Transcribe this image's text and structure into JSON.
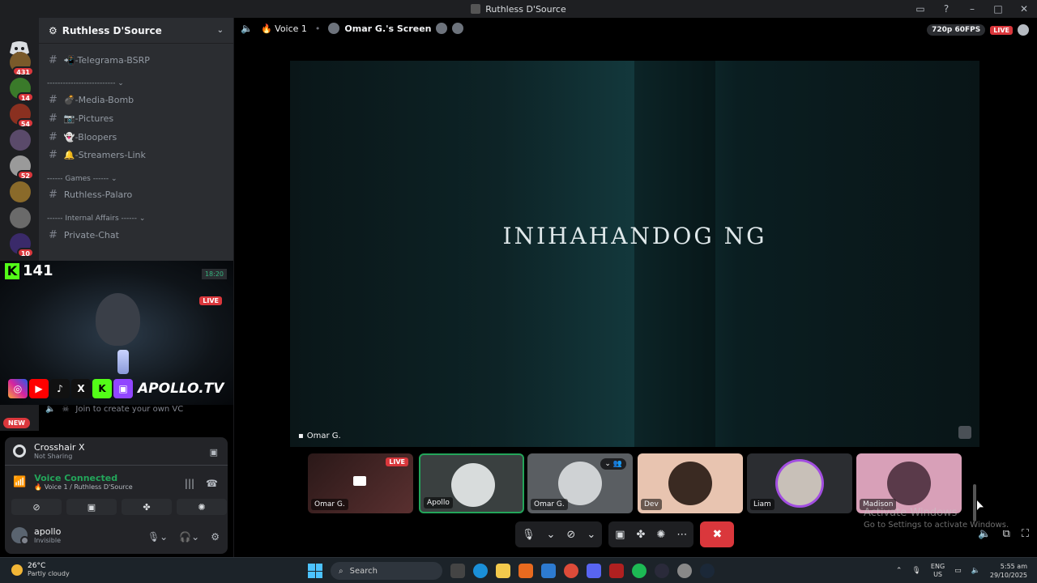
{
  "window": {
    "title": "Ruthless D'Source"
  },
  "guilds": [
    {
      "badge": "431",
      "color": "#7a5a2a"
    },
    {
      "badge": "14",
      "color": "#3a7a2a"
    },
    {
      "badge": "54",
      "color": "#8a3020"
    },
    {
      "badge": "",
      "color": "#5a4a6a"
    },
    {
      "badge": "52",
      "color": "#9a9a9a"
    },
    {
      "badge": "",
      "color": "#8a6a2a"
    },
    {
      "badge": "",
      "color": "#6a6a6a"
    },
    {
      "badge": "10",
      "color": "#3a2a6a"
    }
  ],
  "server": {
    "name": "Ruthless D'Source",
    "channels": [
      {
        "name": "📲-Telegrama-BSRP"
      },
      {
        "name": "💣-Media-Bomb"
      },
      {
        "name": "📷-Pictures"
      },
      {
        "name": "👻-Bloopers"
      },
      {
        "name": "🔔-Streamers-Link"
      },
      {
        "name": "Ruthless-Palaro"
      },
      {
        "name": "Private-Chat"
      }
    ],
    "categories": {
      "games": "------ Games ------",
      "internal": "------ Internal Affairs ------"
    }
  },
  "webcam": {
    "kick_count": "141",
    "time": "18:20",
    "live": "LIVE",
    "handle": "APOLLO.TV"
  },
  "vc_hint": "Join to create your own VC",
  "new_badge": "NEW",
  "activity": {
    "name": "Crosshair X",
    "status": "Not Sharing"
  },
  "voice": {
    "status": "Voice Connected",
    "location": "🔥 Voice 1 / Ruthless D'Source"
  },
  "user": {
    "name": "apollo",
    "status": "Invisible"
  },
  "stage": {
    "channel": "🔥 Voice 1",
    "screen": "Omar G.'s Screen",
    "quality": "720p 60FPS",
    "live": "LIVE",
    "caption": "INIHAHANDOG NG",
    "streamer": "Omar G."
  },
  "tiles": [
    {
      "name": "Omar G.",
      "live": "LIVE",
      "color": "#4a2a2a"
    },
    {
      "name": "Apollo",
      "live": "",
      "color": "#3a4040"
    },
    {
      "name": "Omar G.",
      "live": "",
      "color": "#5a5e62"
    },
    {
      "name": "Dev",
      "live": "",
      "color": "#e8c4b0"
    },
    {
      "name": "Liam",
      "live": "",
      "color": "#2b2d31"
    },
    {
      "name": "Madison",
      "live": "",
      "color": "#d8a0b8"
    }
  ],
  "watermark": {
    "line1": "Activate Windows",
    "line2": "Go to Settings to activate Windows."
  },
  "taskbar": {
    "temp": "26°C",
    "weather": "Partly cloudy",
    "search": "Search",
    "lang1": "ENG",
    "lang2": "US",
    "time": "5:55 am",
    "date": "29/10/2025"
  }
}
